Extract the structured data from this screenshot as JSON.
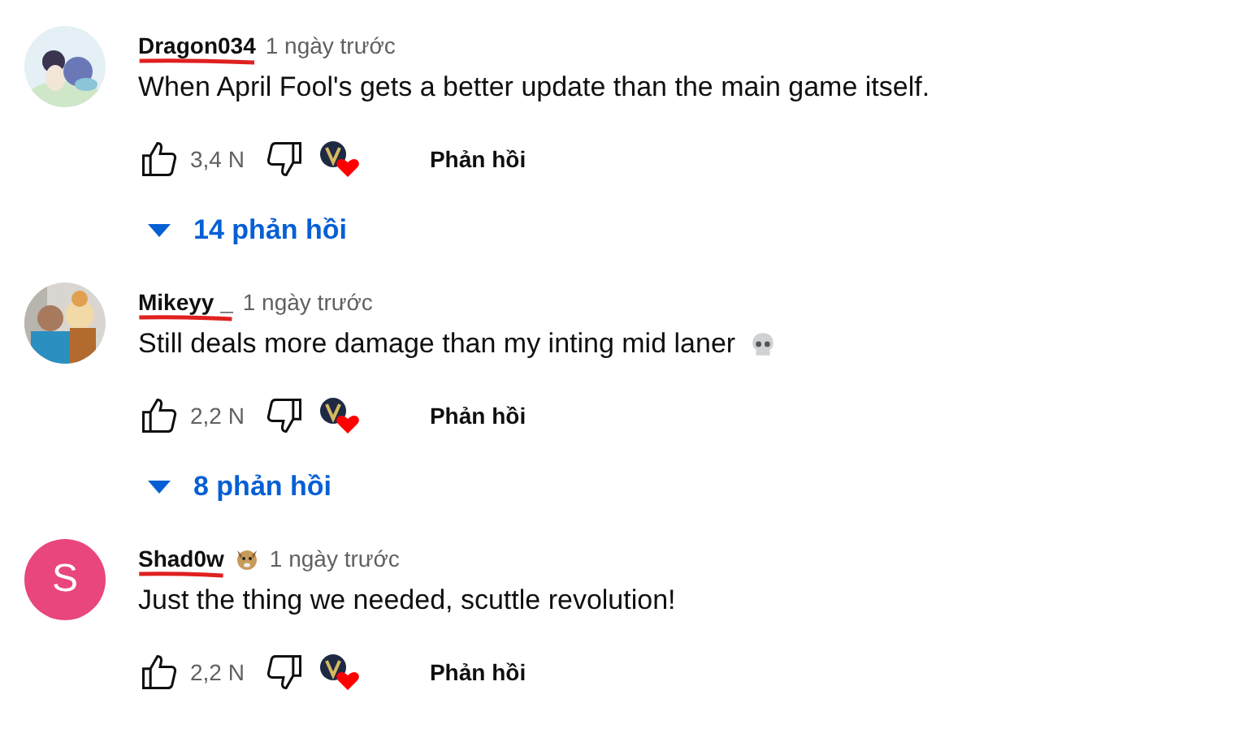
{
  "comments": [
    {
      "author": "Dragon034",
      "author_struck": true,
      "time": "1 ngày trước",
      "text": "When April Fool's gets a better update than the main game itself.",
      "likes": "3,4 N",
      "hearted": true,
      "reply_button": "Phản hồi",
      "replies_toggle": "14 phản hồi"
    },
    {
      "author": "Mikeyy _",
      "author_struck": true,
      "time": "1 ngày trước",
      "text": "Still deals more damage than my inting mid laner",
      "skull": true,
      "likes": "2,2 N",
      "hearted": true,
      "reply_button": "Phản hồi",
      "replies_toggle": "8 phản hồi"
    },
    {
      "avatar": {
        "kind": "letter",
        "letter": "S",
        "color": "#e8467c"
      },
      "author": "Shad0w",
      "author_struck": true,
      "author_badge": true,
      "time": "1 ngày trước",
      "text": "Just the thing we needed, scuttle revolution!",
      "likes": "2,2 N",
      "hearted": true,
      "reply_button": "Phản hồi"
    }
  ]
}
